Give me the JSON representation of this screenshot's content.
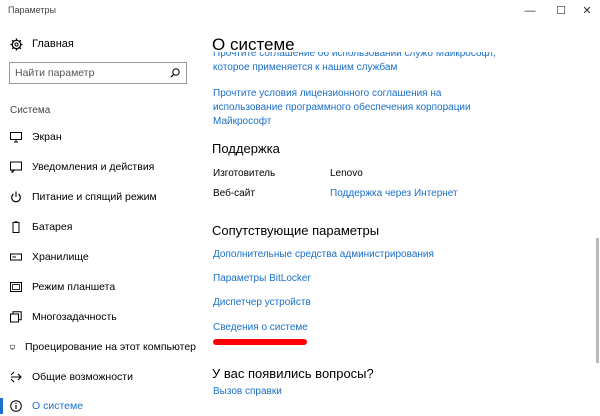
{
  "window": {
    "title": "Параметры",
    "minimize": "—",
    "maximize": "☐",
    "close": "✕"
  },
  "sidebar": {
    "home_label": "Главная",
    "search_placeholder": "Найти параметр",
    "section_label": "Система",
    "items": [
      {
        "label": "Экран",
        "icon": "monitor-icon"
      },
      {
        "label": "Уведомления и действия",
        "icon": "notifications-icon"
      },
      {
        "label": "Питание и спящий режим",
        "icon": "power-icon"
      },
      {
        "label": "Батарея",
        "icon": "battery-icon"
      },
      {
        "label": "Хранилище",
        "icon": "storage-icon"
      },
      {
        "label": "Режим планшета",
        "icon": "tablet-icon"
      },
      {
        "label": "Многозадачность",
        "icon": "multitasking-icon"
      },
      {
        "label": "Проецирование на этот компьютер",
        "icon": "projecting-icon"
      },
      {
        "label": "Общие возможности",
        "icon": "shared-experiences-icon"
      },
      {
        "label": "О системе",
        "icon": "info-icon",
        "active": true
      }
    ]
  },
  "main": {
    "title": "О системе",
    "clipped_link": [
      "Прочтите соглашение об использовании служб Майкрософт,",
      "которое применяется к нашим службам"
    ],
    "license_link": [
      "Прочтите условия лицензионного соглашения на",
      "использование программного обеспечения корпорации",
      "Майкрософт"
    ],
    "support": {
      "heading": "Поддержка",
      "manufacturer_label": "Изготовитель",
      "manufacturer_value": "Lenovo",
      "website_label": "Веб-сайт",
      "website_value": "Поддержка через Интернет"
    },
    "related": {
      "heading": "Сопутствующие параметры",
      "links": [
        "Дополнительные средства администрирования",
        "Параметры BitLocker",
        "Диспетчер устройств",
        "Сведения о системе"
      ]
    },
    "questions": {
      "heading": "У вас появились вопросы?",
      "help_link": "Вызов справки"
    }
  },
  "colors": {
    "accent": "#1a6fc9",
    "annotation": "#ff0000"
  }
}
